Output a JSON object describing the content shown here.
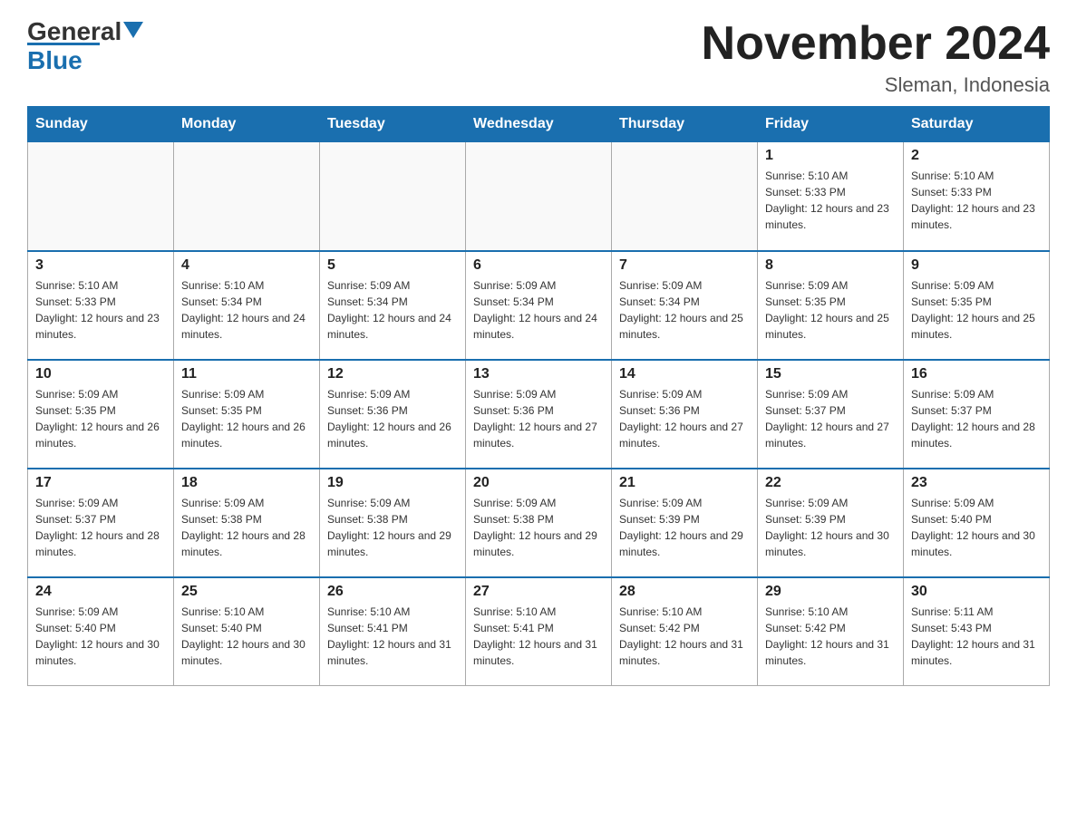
{
  "logo": {
    "text_general": "General",
    "text_blue": "Blue"
  },
  "header": {
    "title": "November 2024",
    "subtitle": "Sleman, Indonesia"
  },
  "weekdays": [
    "Sunday",
    "Monday",
    "Tuesday",
    "Wednesday",
    "Thursday",
    "Friday",
    "Saturday"
  ],
  "weeks": [
    [
      {
        "day": "",
        "sunrise": "",
        "sunset": "",
        "daylight": ""
      },
      {
        "day": "",
        "sunrise": "",
        "sunset": "",
        "daylight": ""
      },
      {
        "day": "",
        "sunrise": "",
        "sunset": "",
        "daylight": ""
      },
      {
        "day": "",
        "sunrise": "",
        "sunset": "",
        "daylight": ""
      },
      {
        "day": "",
        "sunrise": "",
        "sunset": "",
        "daylight": ""
      },
      {
        "day": "1",
        "sunrise": "Sunrise: 5:10 AM",
        "sunset": "Sunset: 5:33 PM",
        "daylight": "Daylight: 12 hours and 23 minutes."
      },
      {
        "day": "2",
        "sunrise": "Sunrise: 5:10 AM",
        "sunset": "Sunset: 5:33 PM",
        "daylight": "Daylight: 12 hours and 23 minutes."
      }
    ],
    [
      {
        "day": "3",
        "sunrise": "Sunrise: 5:10 AM",
        "sunset": "Sunset: 5:33 PM",
        "daylight": "Daylight: 12 hours and 23 minutes."
      },
      {
        "day": "4",
        "sunrise": "Sunrise: 5:10 AM",
        "sunset": "Sunset: 5:34 PM",
        "daylight": "Daylight: 12 hours and 24 minutes."
      },
      {
        "day": "5",
        "sunrise": "Sunrise: 5:09 AM",
        "sunset": "Sunset: 5:34 PM",
        "daylight": "Daylight: 12 hours and 24 minutes."
      },
      {
        "day": "6",
        "sunrise": "Sunrise: 5:09 AM",
        "sunset": "Sunset: 5:34 PM",
        "daylight": "Daylight: 12 hours and 24 minutes."
      },
      {
        "day": "7",
        "sunrise": "Sunrise: 5:09 AM",
        "sunset": "Sunset: 5:34 PM",
        "daylight": "Daylight: 12 hours and 25 minutes."
      },
      {
        "day": "8",
        "sunrise": "Sunrise: 5:09 AM",
        "sunset": "Sunset: 5:35 PM",
        "daylight": "Daylight: 12 hours and 25 minutes."
      },
      {
        "day": "9",
        "sunrise": "Sunrise: 5:09 AM",
        "sunset": "Sunset: 5:35 PM",
        "daylight": "Daylight: 12 hours and 25 minutes."
      }
    ],
    [
      {
        "day": "10",
        "sunrise": "Sunrise: 5:09 AM",
        "sunset": "Sunset: 5:35 PM",
        "daylight": "Daylight: 12 hours and 26 minutes."
      },
      {
        "day": "11",
        "sunrise": "Sunrise: 5:09 AM",
        "sunset": "Sunset: 5:35 PM",
        "daylight": "Daylight: 12 hours and 26 minutes."
      },
      {
        "day": "12",
        "sunrise": "Sunrise: 5:09 AM",
        "sunset": "Sunset: 5:36 PM",
        "daylight": "Daylight: 12 hours and 26 minutes."
      },
      {
        "day": "13",
        "sunrise": "Sunrise: 5:09 AM",
        "sunset": "Sunset: 5:36 PM",
        "daylight": "Daylight: 12 hours and 27 minutes."
      },
      {
        "day": "14",
        "sunrise": "Sunrise: 5:09 AM",
        "sunset": "Sunset: 5:36 PM",
        "daylight": "Daylight: 12 hours and 27 minutes."
      },
      {
        "day": "15",
        "sunrise": "Sunrise: 5:09 AM",
        "sunset": "Sunset: 5:37 PM",
        "daylight": "Daylight: 12 hours and 27 minutes."
      },
      {
        "day": "16",
        "sunrise": "Sunrise: 5:09 AM",
        "sunset": "Sunset: 5:37 PM",
        "daylight": "Daylight: 12 hours and 28 minutes."
      }
    ],
    [
      {
        "day": "17",
        "sunrise": "Sunrise: 5:09 AM",
        "sunset": "Sunset: 5:37 PM",
        "daylight": "Daylight: 12 hours and 28 minutes."
      },
      {
        "day": "18",
        "sunrise": "Sunrise: 5:09 AM",
        "sunset": "Sunset: 5:38 PM",
        "daylight": "Daylight: 12 hours and 28 minutes."
      },
      {
        "day": "19",
        "sunrise": "Sunrise: 5:09 AM",
        "sunset": "Sunset: 5:38 PM",
        "daylight": "Daylight: 12 hours and 29 minutes."
      },
      {
        "day": "20",
        "sunrise": "Sunrise: 5:09 AM",
        "sunset": "Sunset: 5:38 PM",
        "daylight": "Daylight: 12 hours and 29 minutes."
      },
      {
        "day": "21",
        "sunrise": "Sunrise: 5:09 AM",
        "sunset": "Sunset: 5:39 PM",
        "daylight": "Daylight: 12 hours and 29 minutes."
      },
      {
        "day": "22",
        "sunrise": "Sunrise: 5:09 AM",
        "sunset": "Sunset: 5:39 PM",
        "daylight": "Daylight: 12 hours and 30 minutes."
      },
      {
        "day": "23",
        "sunrise": "Sunrise: 5:09 AM",
        "sunset": "Sunset: 5:40 PM",
        "daylight": "Daylight: 12 hours and 30 minutes."
      }
    ],
    [
      {
        "day": "24",
        "sunrise": "Sunrise: 5:09 AM",
        "sunset": "Sunset: 5:40 PM",
        "daylight": "Daylight: 12 hours and 30 minutes."
      },
      {
        "day": "25",
        "sunrise": "Sunrise: 5:10 AM",
        "sunset": "Sunset: 5:40 PM",
        "daylight": "Daylight: 12 hours and 30 minutes."
      },
      {
        "day": "26",
        "sunrise": "Sunrise: 5:10 AM",
        "sunset": "Sunset: 5:41 PM",
        "daylight": "Daylight: 12 hours and 31 minutes."
      },
      {
        "day": "27",
        "sunrise": "Sunrise: 5:10 AM",
        "sunset": "Sunset: 5:41 PM",
        "daylight": "Daylight: 12 hours and 31 minutes."
      },
      {
        "day": "28",
        "sunrise": "Sunrise: 5:10 AM",
        "sunset": "Sunset: 5:42 PM",
        "daylight": "Daylight: 12 hours and 31 minutes."
      },
      {
        "day": "29",
        "sunrise": "Sunrise: 5:10 AM",
        "sunset": "Sunset: 5:42 PM",
        "daylight": "Daylight: 12 hours and 31 minutes."
      },
      {
        "day": "30",
        "sunrise": "Sunrise: 5:11 AM",
        "sunset": "Sunset: 5:43 PM",
        "daylight": "Daylight: 12 hours and 31 minutes."
      }
    ]
  ]
}
